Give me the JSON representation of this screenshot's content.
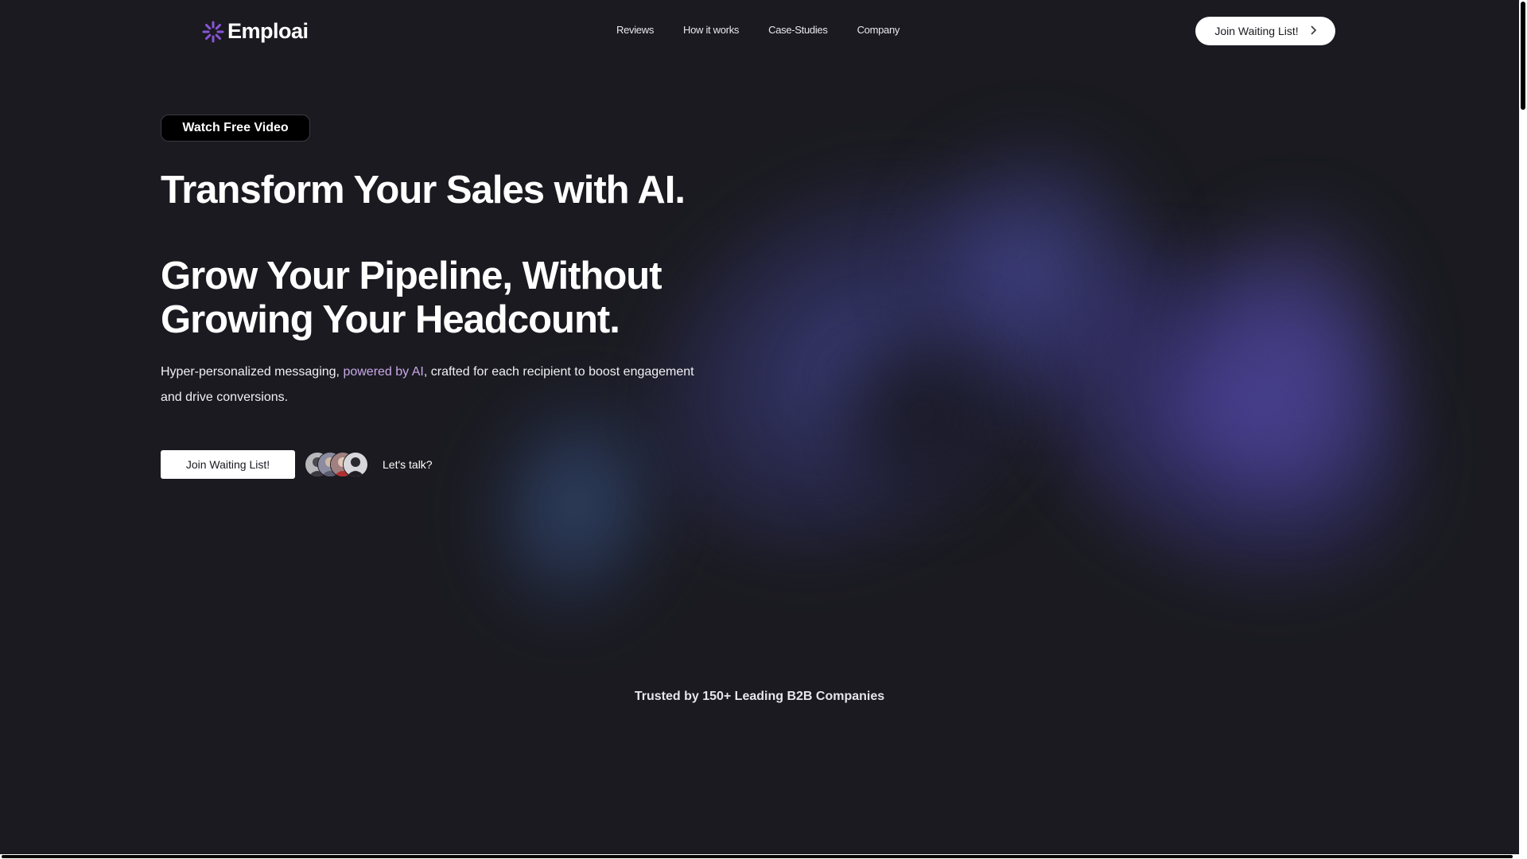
{
  "brand": {
    "name": "Emploai",
    "logo_icon": "sunburst-logo-icon",
    "accent_color": "#8a55d6"
  },
  "nav": {
    "links": [
      "Reviews",
      "How it works",
      "Case-Studies",
      "Company"
    ],
    "cta_label": "Join Waiting List!",
    "cta_icon": "chevron-right-icon"
  },
  "hero": {
    "badge_label": "Watch Free Video",
    "title": "Transform Your Sales with AI.",
    "subtitle": "Grow Your Pipeline, Without Growing Your Headcount.",
    "description_before": "Hyper-personalized messaging, ",
    "description_highlight": "powered by AI",
    "description_after": ", crafted for each recipient to boost engagement and drive conversions.",
    "highlight_color": "#c9a8e8",
    "cta_label": "Join Waiting List!",
    "secondary_label": "Let's talk?"
  },
  "trusted": {
    "text": "Trusted by 150+ Leading B2B Companies"
  }
}
